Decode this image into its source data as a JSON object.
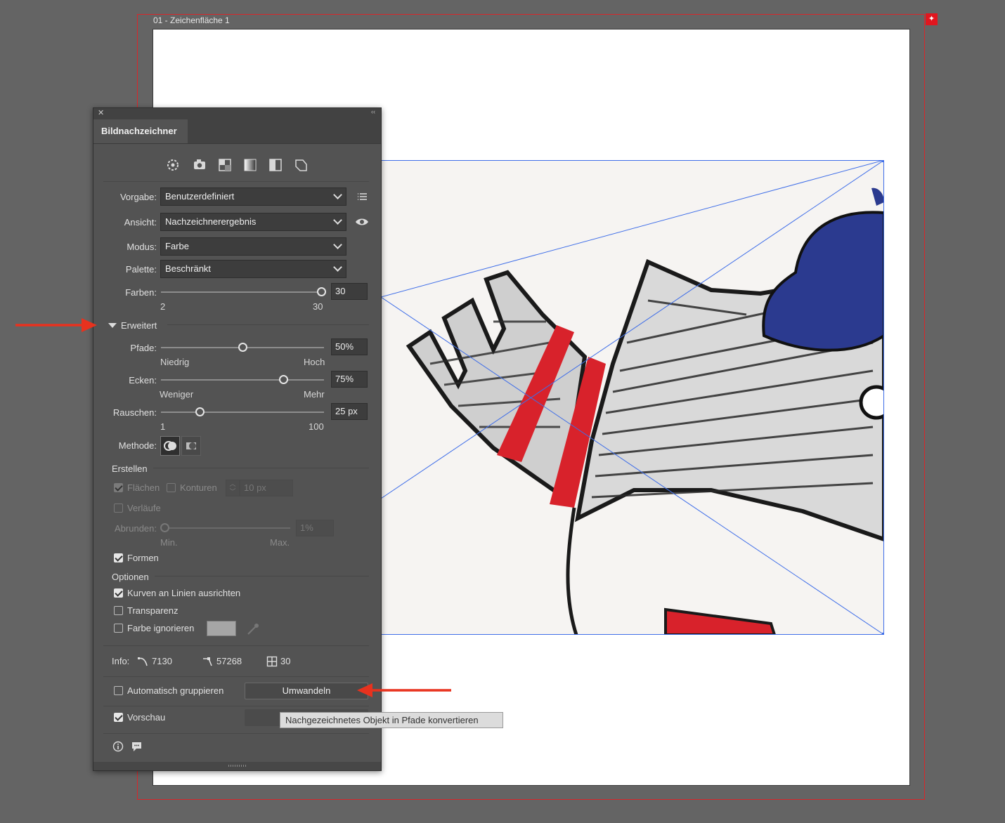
{
  "canvas": {
    "artboard_label": "01 - Zeichenfläche 1",
    "colors": {
      "bleed": "#d8262a",
      "frame": "#3f6ee8",
      "artboard": "#ffffff",
      "background": "#646464"
    }
  },
  "panel": {
    "tab_label": "Bildnachzeichner",
    "close_glyph": "✕",
    "collapse_glyph": "‹‹",
    "preset_icons": [
      "auto-color-icon",
      "photo-high-fidelity-icon",
      "low-color-icon",
      "grayscale-icon",
      "black-white-icon",
      "outline-icon"
    ],
    "vorgabe": {
      "label": "Vorgabe:",
      "value": "Benutzerdefiniert"
    },
    "ansicht": {
      "label": "Ansicht:",
      "value": "Nachzeichnerergebnis"
    },
    "modus": {
      "label": "Modus:",
      "value": "Farbe"
    },
    "palette": {
      "label": "Palette:",
      "value": "Beschränkt"
    },
    "farben": {
      "label": "Farben:",
      "value": "30",
      "min": "2",
      "max": "30",
      "level": 1.0
    },
    "erweitert": {
      "label": "Erweitert"
    },
    "pfade": {
      "label": "Pfade:",
      "value": "50%",
      "min": "Niedrig",
      "max": "Hoch",
      "level": 0.5
    },
    "ecken": {
      "label": "Ecken:",
      "value": "75%",
      "min": "Weniger",
      "max": "Mehr",
      "level": 0.75
    },
    "rauschen": {
      "label": "Rauschen:",
      "value": "25 px",
      "min": "1",
      "max": "100",
      "level": 0.24
    },
    "methode": {
      "label": "Methode:"
    },
    "erstellen": {
      "heading": "Erstellen",
      "flaechen": "Flächen",
      "konturen": "Konturen",
      "kontur_value": "10 px",
      "verlaeufe": "Verläufe",
      "abrunden": {
        "label": "Abrunden:",
        "value": "1%",
        "min": "Min.",
        "max": "Max."
      },
      "formen": "Formen"
    },
    "optionen": {
      "heading": "Optionen",
      "kurven": "Kurven an Linien ausrichten",
      "transparenz": "Transparenz",
      "farbe_ignorieren": "Farbe ignorieren",
      "ignore_color": "#a6a6a6"
    },
    "info": {
      "label": "Info:",
      "paths": "7130",
      "anchors": "57268",
      "colors": "30"
    },
    "auto_group": "Automatisch gruppieren",
    "convert_button": "Umwandeln",
    "preview": "Vorschau"
  },
  "tooltip": "Nachgezeichnetes Objekt in Pfade konvertieren",
  "annotation_color": "#e8321e"
}
